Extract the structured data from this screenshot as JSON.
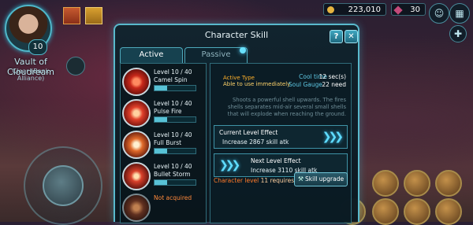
{
  "hud": {
    "player_level": "10",
    "map_name": "Vault of Cloudream",
    "map_sub": "Clear (Bank Alliance)",
    "gold": "223,010",
    "gems": "30"
  },
  "modal": {
    "title": "Character Skill",
    "help_label": "?",
    "close_label": "✕",
    "tabs": [
      {
        "label": "Active",
        "active": true
      },
      {
        "label": "Passive",
        "active": false
      }
    ]
  },
  "skills": [
    {
      "level": "Level 10 / 40",
      "name": "Camel Spin",
      "progress": 0.3
    },
    {
      "level": "Level 10 / 40",
      "name": "Pulse Fire",
      "progress": 0.3
    },
    {
      "level": "Level 10 / 40",
      "name": "Full Burst",
      "progress": 0.3
    },
    {
      "level": "Level 10 / 40",
      "name": "Bullet Storm",
      "progress": 0.3
    },
    {
      "level": "Not acquired",
      "name": "",
      "progress": 0
    }
  ],
  "detail": {
    "type_label": "Active Type",
    "state": "Able to use immediately",
    "cool_label": "Cool time",
    "cool_value": "12 sec(s)",
    "soul_label": "Soul Gauge",
    "soul_value": "22 need",
    "description": "Shoots a powerful shell upwards. The fires shells separates mid-air several small shells that will explode when reaching the ground.",
    "current_effect_title": "Current Level Effect",
    "current_effect_value": "Increase 2867 skill atk",
    "next_effect_title": "Next Level Effect",
    "next_effect_value": "Increase 3110 skill atk",
    "requirement_label": "Character level",
    "requirement_value": "11 requires",
    "upgrade_label": "Skill upgrade"
  },
  "colors": {
    "accent": "#59b9cc",
    "warning": "#ff7a2a",
    "highlight": "#ffb02a"
  },
  "icons": {
    "chevrons": "❯❯❯"
  }
}
